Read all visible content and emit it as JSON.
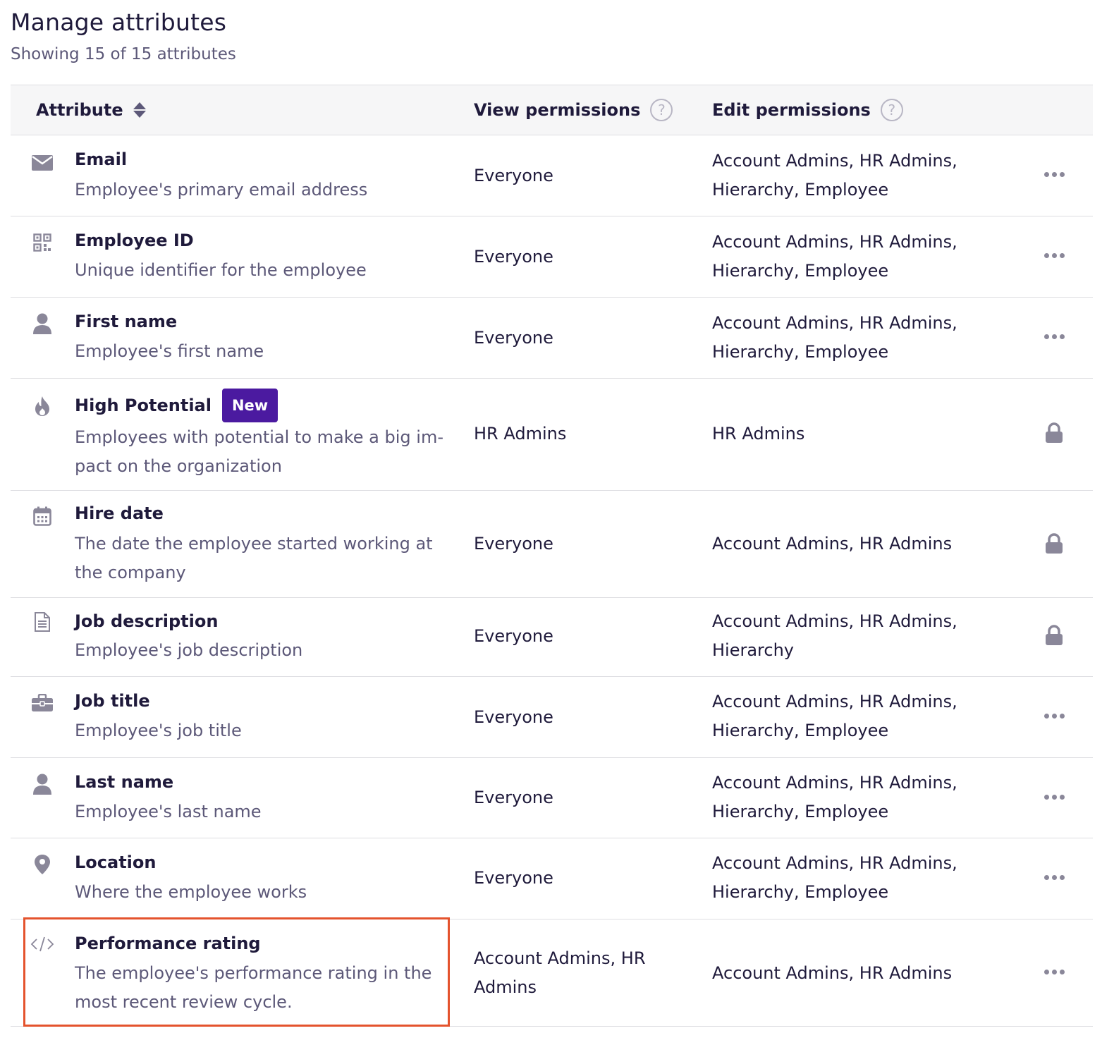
{
  "header": {
    "title": "Manage attributes",
    "subtitle": "Showing 15 of 15 attributes"
  },
  "table": {
    "columns": {
      "attribute": "Attribute",
      "view": "View permissions",
      "edit": "Edit permissions",
      "help_glyph": "?"
    },
    "rows": [
      {
        "icon": "envelope-icon",
        "name": "Email",
        "description": "Employee's primary email address",
        "view": "Everyone",
        "edit": "Account Admins, HR Admins, Hierarchy, Employee",
        "action": "more-options"
      },
      {
        "icon": "qr-code-icon",
        "name": "Employee ID",
        "description": "Unique identifier for the employee",
        "view": "Everyone",
        "edit": "Account Admins, HR Admins, Hierarchy, Employee",
        "action": "more-options"
      },
      {
        "icon": "person-icon",
        "name": "First name",
        "description": "Employee's first name",
        "view": "Everyone",
        "edit": "Account Admins, HR Admins, Hierarchy, Employee",
        "action": "more-options"
      },
      {
        "icon": "flame-icon",
        "name": "High Potential",
        "badge": "New",
        "description": "Employees with potential to make a big im-pact on the organization",
        "view": "HR Admins",
        "edit": "HR Admins",
        "action": "locked"
      },
      {
        "icon": "calendar-icon",
        "name": "Hire date",
        "description": "The date the employee started working at the company",
        "view": "Everyone",
        "edit": "Account Admins, HR Admins",
        "action": "locked"
      },
      {
        "icon": "document-icon",
        "name": "Job description",
        "description": "Employee's job description",
        "view": "Everyone",
        "edit": "Account Admins, HR Admins, Hierarchy",
        "action": "locked"
      },
      {
        "icon": "briefcase-icon",
        "name": "Job title",
        "description": "Employee's job title",
        "view": "Everyone",
        "edit": "Account Admins, HR Admins, Hierarchy, Employee",
        "action": "more-options"
      },
      {
        "icon": "person-icon",
        "name": "Last name",
        "description": "Employee's last name",
        "view": "Everyone",
        "edit": "Account Admins, HR Admins, Hierarchy, Employee",
        "action": "more-options"
      },
      {
        "icon": "location-pin-icon",
        "name": "Location",
        "description": "Where the employee works",
        "view": "Everyone",
        "edit": "Account Admins, HR Admins, Hierarchy, Employee",
        "action": "more-options"
      },
      {
        "icon": "code-icon",
        "name": "Performance rating",
        "description": "The employee's performance rating in the most recent review cycle.",
        "view": "Account Admins, HR Admins",
        "edit": "Account Admins, HR Admins",
        "action": "more-options",
        "highlighted": true
      }
    ]
  },
  "colors": {
    "text_primary": "#1f1a3b",
    "text_secondary": "#5c5878",
    "badge_new": "#4b1aa0",
    "highlight_border": "#e4532d",
    "icon_gray": "#8a8799"
  }
}
